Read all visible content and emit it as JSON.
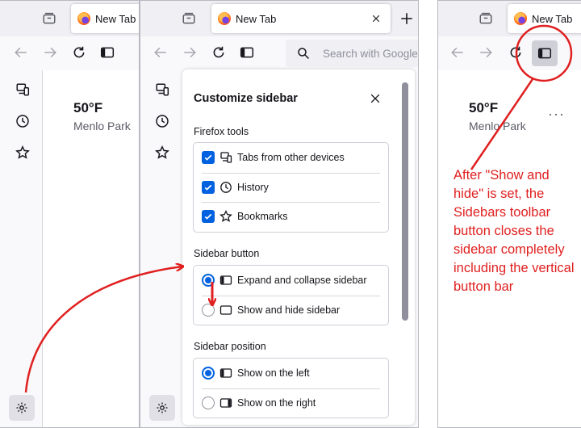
{
  "tab_title": "New Tab",
  "search_placeholder": "Search with Google or e",
  "weather": {
    "temp": "50°F",
    "location": "Menlo Park"
  },
  "panel": {
    "title": "Customize sidebar",
    "tools_title": "Firefox tools",
    "tools": [
      {
        "label": "Tabs from other devices",
        "icon": "synced-tabs-icon",
        "checked": true
      },
      {
        "label": "History",
        "icon": "history-icon",
        "checked": true
      },
      {
        "label": "Bookmarks",
        "icon": "bookmarks-icon",
        "checked": true
      }
    ],
    "button_title": "Sidebar button",
    "button_options": [
      {
        "label": "Expand and collapse sidebar",
        "icon": "sidebar-collapse-icon",
        "selected": true
      },
      {
        "label": "Show and hide sidebar",
        "icon": "sidebar-hide-icon",
        "selected": false
      }
    ],
    "position_title": "Sidebar position",
    "position_options": [
      {
        "label": "Show on the left",
        "icon": "sidebar-left-icon",
        "selected": true
      },
      {
        "label": "Show on the right",
        "icon": "sidebar-right-icon",
        "selected": false
      }
    ]
  },
  "annotation": "After \"Show and hide\" is set, the Sidebars toolbar button closes the sidebar completely including the vertical button bar",
  "colors": {
    "annotation": "#e02020",
    "accent": "#0061e0"
  }
}
